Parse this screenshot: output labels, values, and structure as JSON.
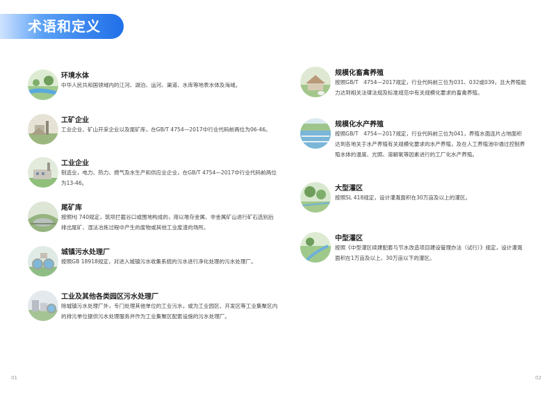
{
  "header": {
    "title": "术语和定义"
  },
  "left_items": [
    {
      "title": "环境水体",
      "desc": "中华人民共和国领域内的江河、湖泊、运河、渠道、水库等地表水体及海域。",
      "icon": "river-landscape-icon"
    },
    {
      "title": "工矿企业",
      "desc": "工业企业、矿山开采企业以及尾矿库，在GB/T 4754—2017中行业代码前两位为06-46。",
      "icon": "mining-factory-icon"
    },
    {
      "title": "工业企业",
      "desc": "制造业，电力、热力、燃气及水生产和供应业企业，在GB/T 4754—2017中行业代码前两位为13-46。",
      "icon": "industrial-plant-icon"
    },
    {
      "title": "尾矿库",
      "desc": "按照HJ 740规定，筑坝拦截谷口或围地构成的，用以堆存金属、非金属矿山进行矿石选别后排出尾矿、湿法冶炼过程中产生的废物或其他工业废渣的场所。",
      "icon": "tailings-pond-icon"
    },
    {
      "title": "城镇污水处理厂",
      "desc": "按照GB 18918规定，对进入城镇污水收集系统的污水进行净化处理的污水处理厂。",
      "icon": "sewage-plant-icon"
    },
    {
      "title": "工业及其他各类园区污水处理厂",
      "desc": "除城镇污水处理厂外，专门处理其他单位的工业污水，或为工业园区、开发区等工业集聚区内的排污单位提供污水处理服务并作为工业集聚区配套设施的污水处理厂。",
      "icon": "industrial-park-plant-icon"
    }
  ],
  "right_items": [
    {
      "title": "规模化畜禽养殖",
      "desc": "按照GB/T　4754—2017规定，行业代码前三位为031、032或039，且大养殖能力达到相关法律法规及标准规范中有关规模化要求的畜禽养殖。",
      "icon": "livestock-farm-icon"
    },
    {
      "title": "规模化水产养殖",
      "desc": "按照GB/T　4754—2017规定，行业代码前三位为041，养殖水面连片占地面积达到各地关于水产养殖有关规模化要求的水产养殖，及在人工养殖池中通过控制养殖水体的温度、光照、溶解氧等因素进行的工厂化水产养殖。",
      "icon": "aquaculture-icon"
    },
    {
      "title": "大型灌区",
      "desc": "按照SL 418规定，设计灌溉面积在30万亩及以上的灌区。",
      "icon": "large-irrigation-icon"
    },
    {
      "title": "中型灌区",
      "desc": "按照《中型灌区续建配套与节水改造项目建设管理办法（试行）》规定，设计灌溉面积在1万亩及以上、30万亩以下的灌区。",
      "icon": "medium-irrigation-icon"
    }
  ],
  "footer": {
    "left_page": "01",
    "right_page": "02"
  }
}
